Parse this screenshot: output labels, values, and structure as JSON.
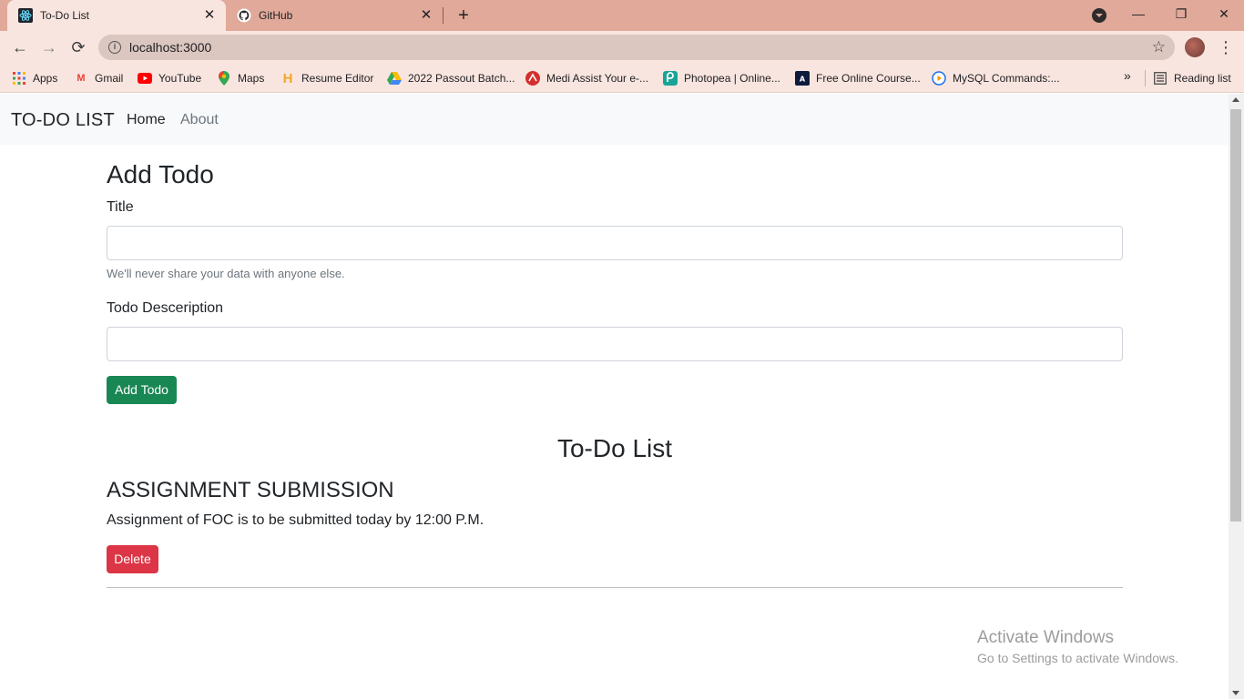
{
  "browser": {
    "tabs": [
      {
        "title": "To-Do List",
        "icon": "react-icon",
        "active": true
      },
      {
        "title": "GitHub",
        "icon": "github-icon",
        "active": false
      }
    ],
    "address": "localhost:3000",
    "bookmarks": [
      {
        "label": "Apps",
        "icon": "apps-grid-icon"
      },
      {
        "label": "Gmail",
        "icon": "gmail-icon"
      },
      {
        "label": "YouTube",
        "icon": "youtube-icon"
      },
      {
        "label": "Maps",
        "icon": "maps-icon"
      },
      {
        "label": "Resume Editor",
        "icon": "resume-icon"
      },
      {
        "label": "2022 Passout Batch...",
        "icon": "drive-icon"
      },
      {
        "label": "Medi Assist Your e-...",
        "icon": "medi-assist-icon"
      },
      {
        "label": "Photopea | Online...",
        "icon": "photopea-icon"
      },
      {
        "label": "Free Online Course...",
        "icon": "courses-icon"
      },
      {
        "label": "MySQL Commands:...",
        "icon": "mysql-icon"
      }
    ],
    "more_bookmarks": "»",
    "reading_list": "Reading list"
  },
  "app": {
    "brand": "TO-DO LIST",
    "nav": {
      "home": "Home",
      "about": "About"
    }
  },
  "form": {
    "heading": "Add Todo",
    "title_label": "Title",
    "title_value": "",
    "title_help": "We'll never share your data with anyone else.",
    "desc_label": "Todo Desceription",
    "desc_value": "",
    "submit": "Add Todo"
  },
  "list": {
    "heading": "To-Do List",
    "items": [
      {
        "title": "ASSIGNMENT SUBMISSION",
        "desc": "Assignment of FOC is to be submitted today by 12:00 P.M.",
        "delete": "Delete"
      }
    ]
  },
  "watermark": {
    "line1": "Activate Windows",
    "line2": "Go to Settings to activate Windows."
  },
  "colors": {
    "success": "#198754",
    "danger": "#dc3545",
    "chrome_frame": "#e0a99a",
    "chrome_toolbar": "#f9e5df"
  }
}
